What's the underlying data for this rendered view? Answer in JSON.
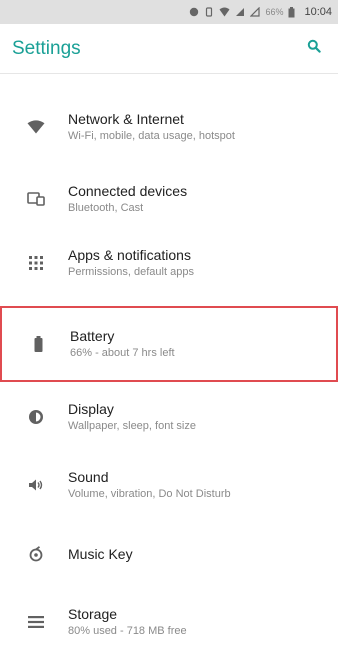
{
  "status_bar": {
    "battery_percent": "66%",
    "time": "10:04"
  },
  "app_bar": {
    "title": "Settings",
    "search_icon": "search-icon"
  },
  "colors": {
    "accent": "#1aa096",
    "highlight_border": "#e04b50"
  },
  "items": [
    {
      "title": "Network & Internet",
      "subtitle": "Wi-Fi, mobile, data usage, hotspot",
      "icon": "wifi-icon"
    },
    {
      "title": "Connected devices",
      "subtitle": "Bluetooth, Cast",
      "icon": "devices-icon"
    },
    {
      "title": "Apps & notifications",
      "subtitle": "Permissions, default apps",
      "icon": "apps-grid-icon"
    },
    {
      "title": "Battery",
      "subtitle": "66% - about 7 hrs left",
      "icon": "battery-icon"
    },
    {
      "title": "Display",
      "subtitle": "Wallpaper, sleep, font size",
      "icon": "brightness-icon"
    },
    {
      "title": "Sound",
      "subtitle": "Volume, vibration, Do Not Disturb",
      "icon": "volume-icon"
    },
    {
      "title": "Music Key",
      "subtitle": "",
      "icon": "music-key-icon"
    },
    {
      "title": "Storage",
      "subtitle": "80% used - 718 MB free",
      "icon": "storage-icon"
    }
  ]
}
